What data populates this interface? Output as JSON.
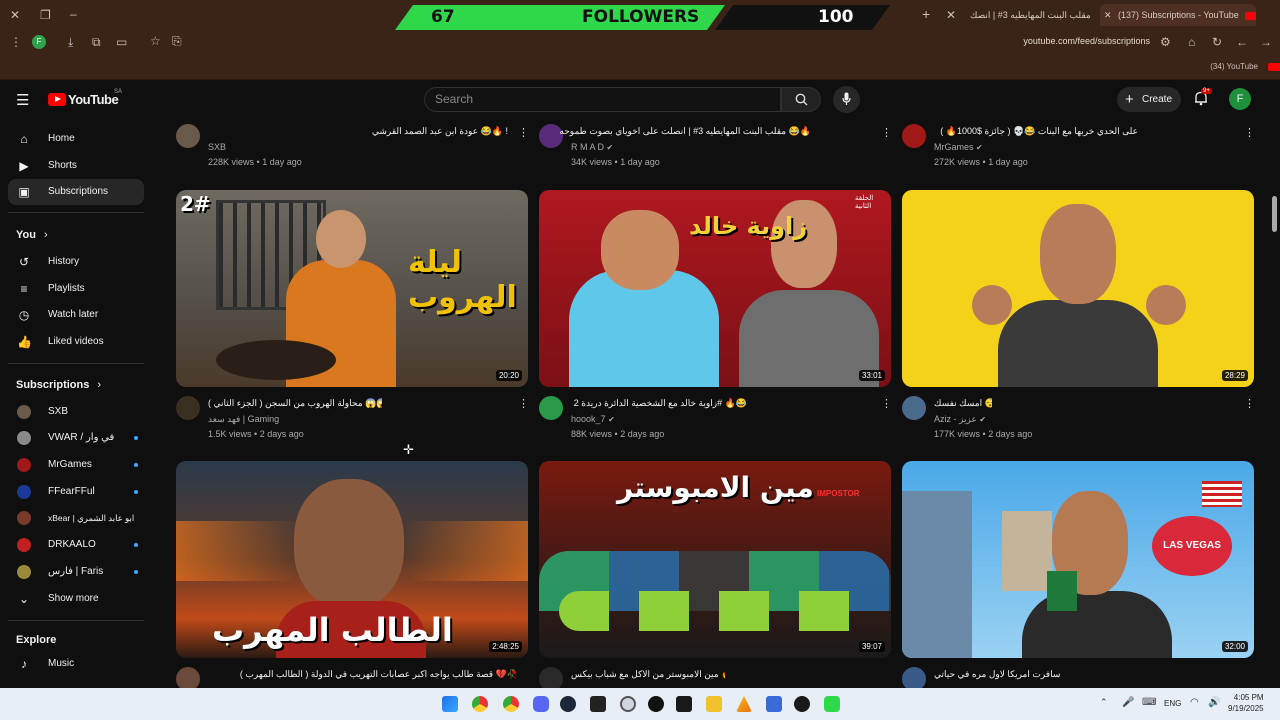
{
  "browser": {
    "tabs": [
      {
        "title": "مقلب البنت المهايطيه 3# | انصك",
        "active": false
      },
      {
        "title": "(137) Subscriptions - YouTube",
        "active": true
      }
    ],
    "url": "youtube.com/feed/subscriptions",
    "profile_initial": "F",
    "bookmark_label": "(34) YouTube"
  },
  "overlay": {
    "left_count": "67",
    "label": "FOLLOWERS",
    "right_count": "100"
  },
  "header": {
    "logo": "YouTube",
    "region": "SA",
    "search_placeholder": "Search",
    "create_label": "Create",
    "notification_badge": "9+",
    "avatar_initial": "F"
  },
  "sidebar": {
    "main": [
      {
        "label": "Home",
        "icon": "home-icon"
      },
      {
        "label": "Shorts",
        "icon": "shorts-icon"
      },
      {
        "label": "Subscriptions",
        "icon": "subscriptions-icon",
        "active": true
      }
    ],
    "you_heading": "You",
    "you_items": [
      {
        "label": "History",
        "icon": "history-icon"
      },
      {
        "label": "Playlists",
        "icon": "playlists-icon"
      },
      {
        "label": "Watch later",
        "icon": "clock-icon"
      },
      {
        "label": "Liked videos",
        "icon": "thumbs-up-icon"
      }
    ],
    "subs_heading": "Subscriptions",
    "subscriptions": [
      {
        "label": "SXB",
        "dot": false
      },
      {
        "label": "VWAR / في وار",
        "dot": true
      },
      {
        "label": "MrGames",
        "dot": true
      },
      {
        "label": "FFearFFul",
        "dot": true
      },
      {
        "label": "xBear | ابو عابد الشمري",
        "dot": false
      },
      {
        "label": "DRKAALO",
        "dot": true
      },
      {
        "label": "فارس | Faris",
        "dot": true
      }
    ],
    "show_more": "Show more",
    "explore_heading": "Explore",
    "explore_items": [
      {
        "label": "Music",
        "icon": "music-icon"
      }
    ]
  },
  "videos_top": [
    {
      "title": "عودة ابن عبد الصمد القرشي 😂🔥 !",
      "channel": "SXB",
      "views": "228K views",
      "age": "1 day ago",
      "verified": false
    },
    {
      "title": "مقلب البنت المهايطيه 3# | انصلت على اخوياي بصوت طموحه 😂🔥",
      "channel": "R M A D",
      "views": "34K views",
      "age": "1 day ago",
      "verified": true
    },
    {
      "title": "على الحدي خربها مع البنات 😂💀 ( جائزة $1000🔥 )",
      "channel": "MrGames",
      "views": "272K views",
      "age": "1 day ago",
      "verified": true
    }
  ],
  "videos_mid": [
    {
      "title": "محاولة الهروب من السجن ( الجزء الثاني ) 😱😱 (",
      "channel": "فهد سعد | Gaming",
      "views": "1.5K views",
      "age": "2 days ago",
      "duration": "20:20",
      "thumb_text": "ليلة الهروب",
      "thumb_corner": "2#",
      "verified": false
    },
    {
      "title": "زاوية خالد مع الشخصية الدائرة دريدة 2# 🔥😂",
      "channel": "hoook_7",
      "views": "88K views",
      "age": "2 days ago",
      "duration": "33:01",
      "thumb_text": "زاوية خالد",
      "thumb_corner": "الحلقة الثانية",
      "verified": true
    },
    {
      "title": "امسك نفسك 😴",
      "channel": "Aziz - عزيز",
      "views": "177K views",
      "age": "2 days ago",
      "duration": "28:29",
      "thumb_text": "",
      "thumb_corner": "",
      "verified": true
    }
  ],
  "videos_bottom": [
    {
      "title": "قصة طالب يواجه اكبر عصابات التهريب في الدولة ( الطالب المهرب ) 💔🥀",
      "duration": "2:48:25",
      "thumb_text": "الطالب المهرب"
    },
    {
      "title": "مين الامبوستر من الاكل مع شباب بيكس 🔥!!",
      "duration": "39:07",
      "thumb_text": "مين الامبوستر",
      "thumb_corner": "IMPOSTOR"
    },
    {
      "title": "سافرت امريكا لاول مره في حياتي US",
      "duration": "32:00",
      "thumb_text": "LAS VEGAS"
    }
  ],
  "taskbar": {
    "lang": "ENG",
    "time": "4:05 PM",
    "date": "9/19/2025"
  },
  "colors": {
    "bg": "#0f0f0f",
    "yt_red": "#ff0000",
    "followers_green": "#2fd84a",
    "chrome_brown": "#3a2418",
    "verified_grey": "#aaaaaa"
  }
}
